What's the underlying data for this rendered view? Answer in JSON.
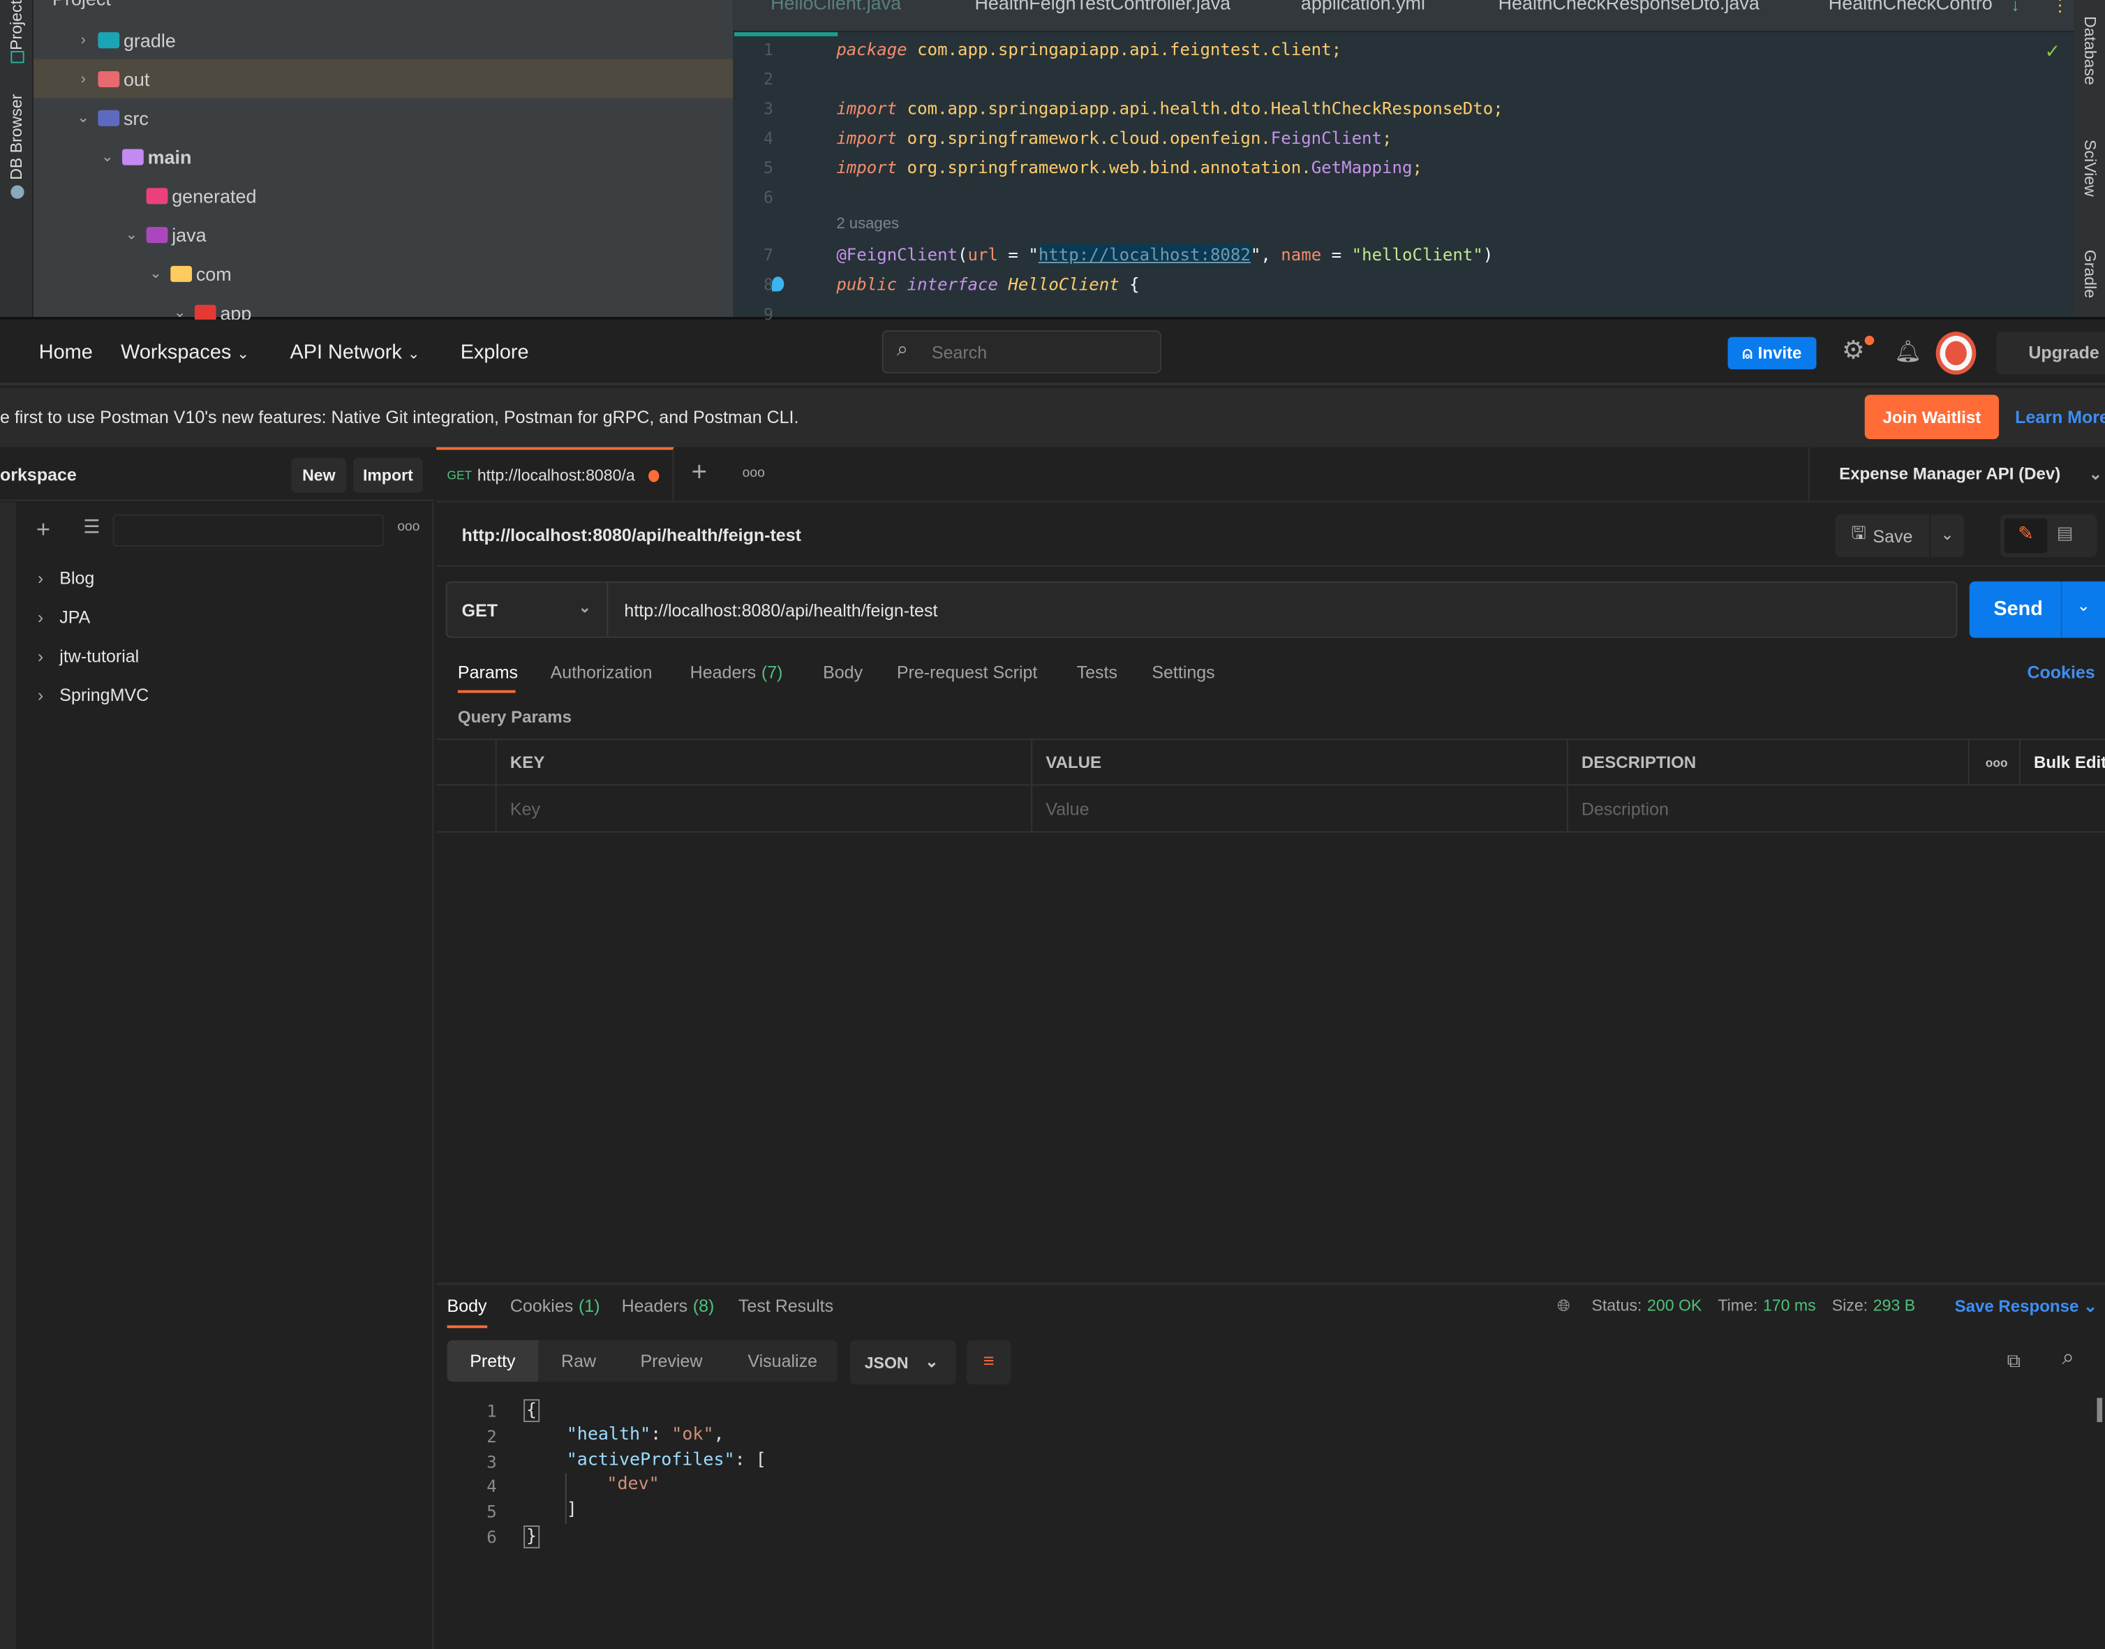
{
  "ide": {
    "left_strip": [
      "Project",
      "DB Browser"
    ],
    "tree_header": "Project",
    "tree": [
      {
        "label": "gradle",
        "expanded": false,
        "color": "#1aa5b4"
      },
      {
        "label": "out",
        "expanded": false,
        "color": "#e8696e",
        "selected": true
      },
      {
        "label": "src",
        "expanded": true,
        "color": "#5c6bc0"
      },
      {
        "label": "main",
        "expanded": true,
        "color": "#c58af0"
      },
      {
        "label": "generated",
        "expanded": null,
        "color": "#ec407a"
      },
      {
        "label": "java",
        "expanded": true,
        "color": "#ab47bc"
      },
      {
        "label": "com",
        "expanded": true,
        "color": "#ffca5f"
      },
      {
        "label": "app",
        "expanded": true,
        "color": "#e53935"
      }
    ],
    "tabs": [
      "HelloClient.java",
      "HealthFeignTestController.java",
      "application.yml",
      "HealthCheckResponseDto.java",
      "HealthCheckContro"
    ],
    "code": {
      "line1_kw": "package",
      "line1": " com.app.springapiapp.api.feigntest.client;",
      "line3_kw": "import",
      "line3": " com.app.springapiapp.api.health.dto.HealthCheckResponseDto;",
      "line4_kw": "import",
      "line4": " org.springframework.cloud.openfeign.",
      "line4_cls": "FeignClient",
      "line5_kw": "import",
      "line5": " org.springframework.web.bind.annotation.",
      "line5_cls": "GetMapping",
      "usages": "2 usages",
      "line7_ann": "@FeignClient",
      "line7_a": "(",
      "line7_url_key": "url",
      " line7_eq": " = \"",
      "line7_url": "http://localhost:8082",
      "line7_b": "\", ",
      "line7_name_key": "name",
      "line7_c": " = ",
      "line7_name": "\"helloClient\"",
      "line7_d": ")",
      "line8_kw1": "public",
      "line8_kw2": "interface",
      "line8_cls": "HelloClient",
      "line8_end": " {"
    },
    "line_numbers": [
      "1",
      "2",
      "3",
      "4",
      "5",
      "6",
      "7",
      "8",
      "9"
    ],
    "right_strip": [
      "Database",
      "SciView",
      "Gradle"
    ]
  },
  "topbar": {
    "nav": [
      "Home",
      "Workspaces",
      "API Network",
      "Explore"
    ],
    "search_placeholder": "Search",
    "invite": "Invite",
    "upgrade": "Upgrade",
    "accent": "#097bed"
  },
  "banner": {
    "text": "e first to use Postman V10's new features: Native Git integration, Postman for gRPC, and Postman CLI.",
    "join": "Join Waitlist",
    "learn": "Learn More",
    "join_color": "#ff6c37"
  },
  "sidebar": {
    "title": "orkspace",
    "new": "New",
    "import": "Import",
    "collections": [
      "Blog",
      "JPA",
      "jtw-tutorial",
      "SpringMVC"
    ]
  },
  "request_tab": {
    "method": "GET",
    "url": "http://localhost:8080/a",
    "unsaved": true
  },
  "environment": "Expense Manager API (Dev)",
  "request": {
    "title": "http://localhost:8080/api/health/feign-test",
    "save": "Save",
    "method": "GET",
    "url": "http://localhost:8080/api/health/feign-test",
    "send": "Send",
    "tabs": [
      {
        "label": "Params"
      },
      {
        "label": "Authorization"
      },
      {
        "label": "Headers",
        "count": "(7)"
      },
      {
        "label": "Body"
      },
      {
        "label": "Pre-request Script"
      },
      {
        "label": "Tests"
      },
      {
        "label": "Settings"
      }
    ],
    "cookies": "Cookies",
    "query_params": "Query Params",
    "columns": [
      "KEY",
      "VALUE",
      "DESCRIPTION"
    ],
    "bulk_edit": "Bulk Edit",
    "placeholders": [
      "Key",
      "Value",
      "Description"
    ]
  },
  "response": {
    "tabs": [
      {
        "label": "Body"
      },
      {
        "label": "Cookies",
        "count": "(1)"
      },
      {
        "label": "Headers",
        "count": "(8)"
      },
      {
        "label": "Test Results"
      }
    ],
    "status_label": "Status:",
    "status": "200 OK",
    "time_label": "Time:",
    "time": "170 ms",
    "size_label": "Size:",
    "size": "293 B",
    "save_response": "Save Response",
    "views": [
      "Pretty",
      "Raw",
      "Preview",
      "Visualize"
    ],
    "format": "JSON",
    "lines": [
      "1",
      "2",
      "3",
      "4",
      "5",
      "6"
    ],
    "body": {
      "l1": "{",
      "k1": "\"health\"",
      "v1": "\"ok\"",
      "k2": "\"activeProfiles\"",
      "v2": "\"dev\"",
      "l5": "]",
      "l6": "}"
    }
  }
}
